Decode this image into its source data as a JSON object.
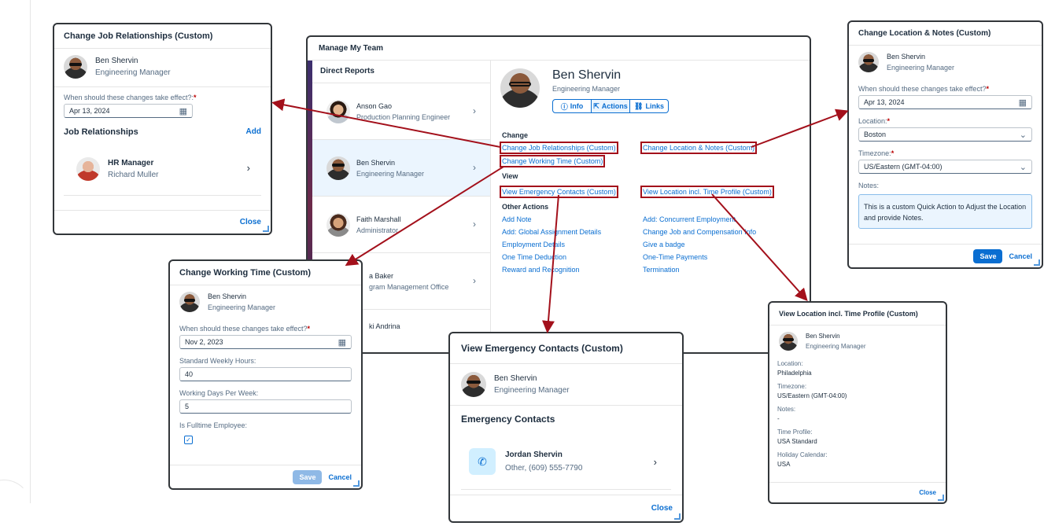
{
  "manage_team": {
    "title": "Manage My Team",
    "direct_reports_label": "Direct Reports",
    "reports": [
      {
        "name": "Anson Gao",
        "role": "Production Planning Engineer"
      },
      {
        "name": "Ben Shervin",
        "role": "Engineering Manager"
      },
      {
        "name": "Faith Marshall",
        "role": "Administrator"
      },
      {
        "name": "a Baker",
        "role": "gram Management Office"
      },
      {
        "name": "ki Andrina",
        "role": ""
      }
    ],
    "selected": {
      "name": "Ben Shervin",
      "role": "Engineering Manager"
    },
    "tabs": [
      {
        "icon": "ⓘ",
        "label": "Info"
      },
      {
        "icon": "⇱",
        "label": "Actions"
      },
      {
        "icon": "⛓",
        "label": "Links"
      }
    ],
    "change_label": "Change",
    "change_actions": [
      "Change Job Relationships (Custom)",
      "Change Working Time (Custom)",
      "Change Location & Notes (Custom)"
    ],
    "view_label": "View",
    "view_actions": [
      "View Emergency Contacts (Custom)",
      "View Location incl. Time Profile (Custom)"
    ],
    "other_label": "Other Actions",
    "other_left": [
      "Add Note",
      "Add: Global Assignment Details",
      "Employment Details",
      "One Time Deduction",
      "Reward and Recognition"
    ],
    "other_right": [
      "Add: Concurrent Employment",
      "Change Job and Compensation Info",
      "Give a badge",
      "One-Time Payments",
      "Termination"
    ]
  },
  "job_rel": {
    "title": "Change Job Relationships (Custom)",
    "person": {
      "name": "Ben Shervin",
      "role": "Engineering Manager"
    },
    "effect_label": "When should these changes take effect?:",
    "effect_value": "Apr 13, 2024",
    "section": "Job Relationships",
    "add": "Add",
    "rel_title": "HR Manager",
    "rel_name": "Richard Muller",
    "close": "Close"
  },
  "working_time": {
    "title": "Change Working Time (Custom)",
    "person": {
      "name": "Ben Shervin",
      "role": "Engineering Manager"
    },
    "effect_label": "When should these changes take effect?",
    "effect_value": "Nov 2, 2023",
    "hours_label": "Standard Weekly Hours:",
    "hours_value": "40",
    "days_label": "Working Days Per Week:",
    "days_value": "5",
    "fulltime_label": "Is Fulltime Employee:",
    "save": "Save",
    "cancel": "Cancel"
  },
  "emergency": {
    "title": "View Emergency Contacts (Custom)",
    "person": {
      "name": "Ben Shervin",
      "role": "Engineering Manager"
    },
    "section": "Emergency Contacts",
    "contact_name": "Jordan Shervin",
    "contact_detail": "Other, (609) 555-7790",
    "close": "Close"
  },
  "location_notes": {
    "title": "Change Location & Notes (Custom)",
    "person": {
      "name": "Ben Shervin",
      "role": "Engineering Manager"
    },
    "effect_label": "When should these changes take effect?",
    "effect_value": "Apr 13, 2024",
    "location_label": "Location:",
    "location_value": "Boston",
    "tz_label": "Timezone:",
    "tz_value": "US/Eastern (GMT-04:00)",
    "notes_label": "Notes:",
    "notes_value": "This is a custom Quick Action to Adjust the Location and provide Notes.",
    "save": "Save",
    "cancel": "Cancel"
  },
  "loc_time": {
    "title": "View Location incl. Time Profile (Custom)",
    "person": {
      "name": "Ben Shervin",
      "role": "Engineering Manager"
    },
    "location_label": "Location:",
    "location_value": "Philadelphia",
    "tz_label": "Timezone:",
    "tz_value": "US/Eastern (GMT-04:00)",
    "notes_label": "Notes:",
    "notes_value": "-",
    "profile_label": "Time Profile:",
    "profile_value": "USA Standard",
    "holiday_label": "Holiday Calendar:",
    "holiday_value": "USA",
    "close": "Close"
  }
}
